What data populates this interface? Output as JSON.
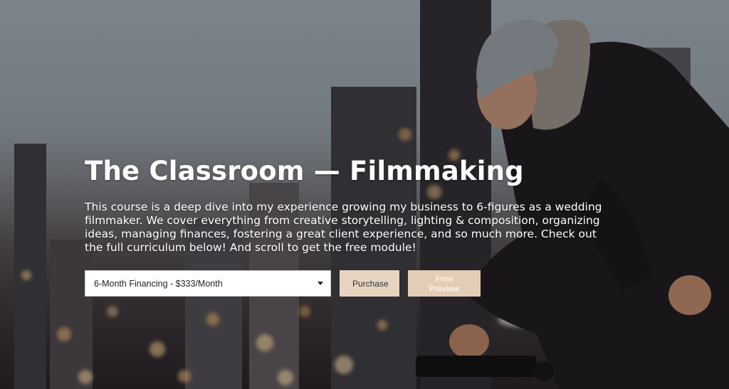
{
  "hero": {
    "title": "The Classroom — Filmmaking",
    "description": "This course is a deep dive into my experience growing my business to 6-figures as a wedding filmmaker. We cover everything from creative storytelling, lighting & composition, organizing ideas, managing finances, fostering a great client experience, and so much more. Check out the full curriculum below! And scroll to get the free module!"
  },
  "purchase": {
    "selected_option": "6-Month Financing - $333/Month",
    "purchase_label": "Purchase",
    "preview_label": "Free Preview"
  },
  "colors": {
    "button_bg": "#e6d4c1",
    "title_text": "#ffffff"
  }
}
